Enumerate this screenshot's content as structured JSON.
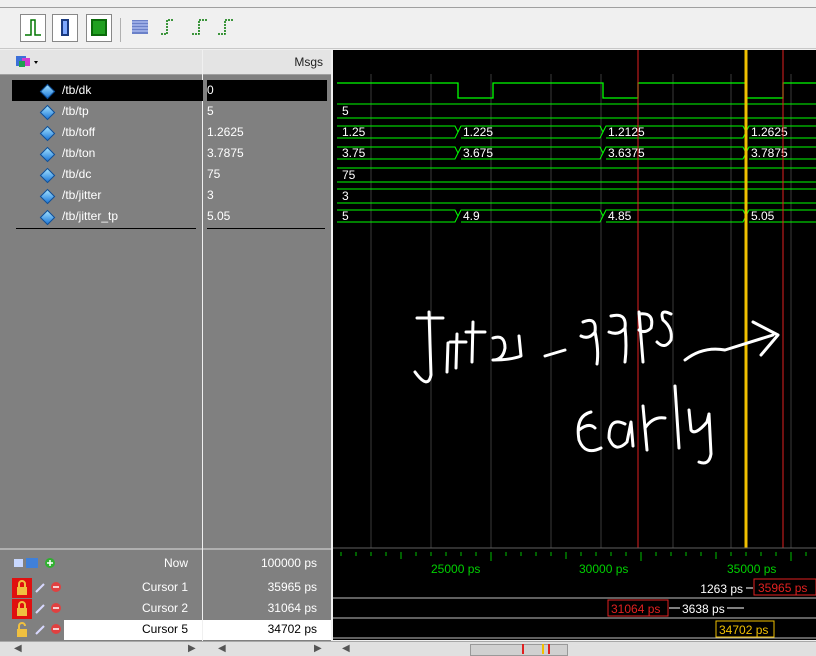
{
  "names_header": "",
  "values_header": "Msgs",
  "signals": [
    {
      "name": "/tb/dk",
      "value": "0"
    },
    {
      "name": "/tb/tp",
      "value": "5"
    },
    {
      "name": "/tb/toff",
      "value": "1.2625"
    },
    {
      "name": "/tb/ton",
      "value": "3.7875"
    },
    {
      "name": "/tb/dc",
      "value": "75"
    },
    {
      "name": "/tb/jitter",
      "value": "3"
    },
    {
      "name": "/tb/jitter_tp",
      "value": "5.05"
    }
  ],
  "wave_labels": {
    "tp": [
      "5"
    ],
    "toff": [
      "1.25",
      "1.225",
      "1.2125",
      "1.2625"
    ],
    "ton": [
      "3.75",
      "3.675",
      "3.6375",
      "3.7875"
    ],
    "dc": [
      "75"
    ],
    "jitter": [
      "3"
    ],
    "jitter_tp": [
      "5",
      "4.9",
      "4.85",
      "5.05"
    ]
  },
  "status": {
    "now_label": "Now",
    "now_value": "100000 ps",
    "cursors": [
      {
        "label": "Cursor 1",
        "value": "35965 ps"
      },
      {
        "label": "Cursor 2",
        "value": "31064 ps"
      },
      {
        "label": "Cursor 5",
        "value": "34702 ps"
      }
    ]
  },
  "timeline": {
    "ticks": [
      "25000 ps",
      "30000 ps",
      "35000 ps"
    ]
  },
  "cursor_tags": {
    "c1": "35965 ps",
    "c2": "31064 ps",
    "c5": "34702 ps",
    "delta_c1": "1263 ps",
    "delta_c2": "3638 ps"
  },
  "annotation": {
    "line1": "Jitter -99ps",
    "line2": "early"
  },
  "colors": {
    "wave": "#00ff00",
    "cursor_red": "#e02020",
    "cursor_active": "#f0c000"
  }
}
